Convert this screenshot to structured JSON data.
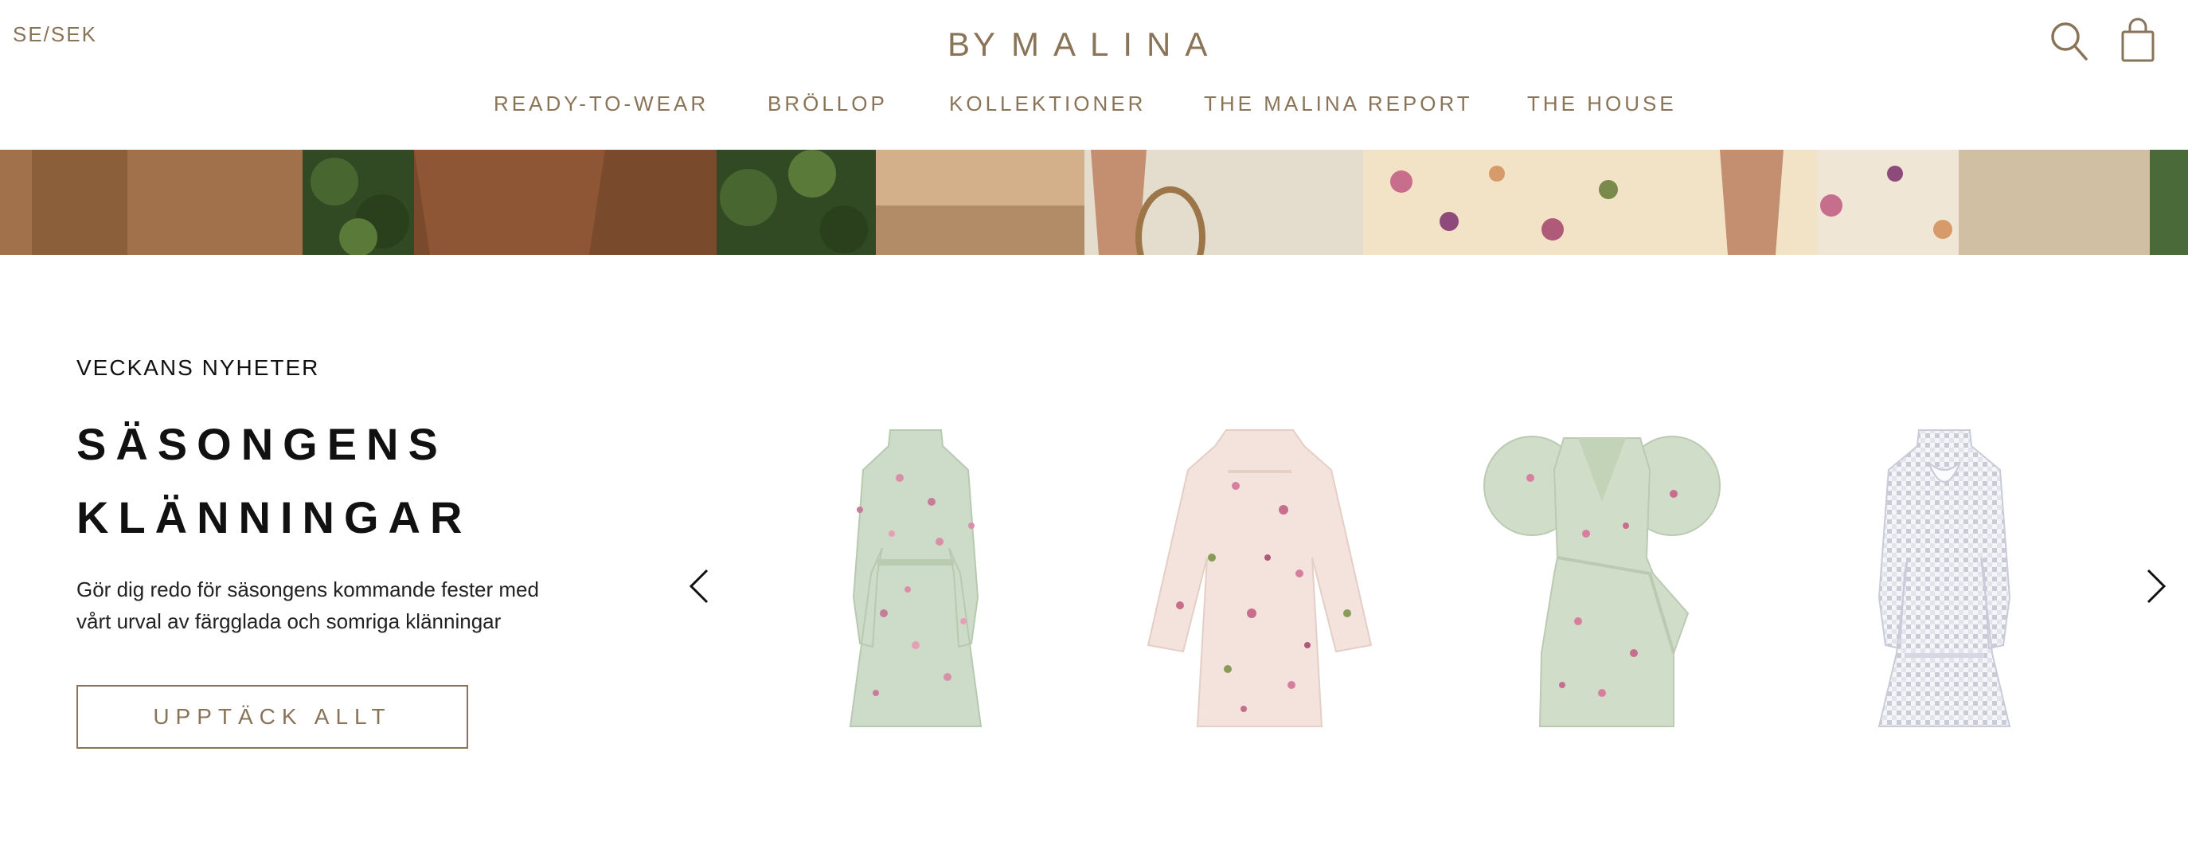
{
  "header": {
    "locale": "SE/SEK",
    "logo": {
      "by": "BY",
      "name": "MALINA"
    },
    "icons": {
      "search": "search-icon",
      "bag": "shopping-bag-icon"
    },
    "nav": [
      {
        "label": "READY-TO-WEAR"
      },
      {
        "label": "BRÖLLOP"
      },
      {
        "label": "KOLLEKTIONER"
      },
      {
        "label": "THE MALINA REPORT"
      },
      {
        "label": "THE HOUSE"
      }
    ]
  },
  "section": {
    "eyebrow": "VECKANS NYHETER",
    "title_line1": "SÄSONGENS",
    "title_line2": "KLÄNNINGAR",
    "description": "Gör dig redo för säsongens kommande fester med vårt urval av färgglada och somriga klänningar",
    "cta": "UPPTÄCK ALLT"
  },
  "carousel": {
    "prev_icon": "chevron-left-icon",
    "next_icon": "chevron-right-icon",
    "products": [
      {
        "icon": "dress-image-mint-floral-long-sleeve"
      },
      {
        "icon": "dress-image-cream-floral-bell-sleeve"
      },
      {
        "icon": "dress-image-mint-floral-puff-sleeve"
      },
      {
        "icon": "dress-image-white-gingham"
      }
    ]
  },
  "colors": {
    "accent": "#8a7458",
    "text": "#111111",
    "background": "#ffffff"
  }
}
